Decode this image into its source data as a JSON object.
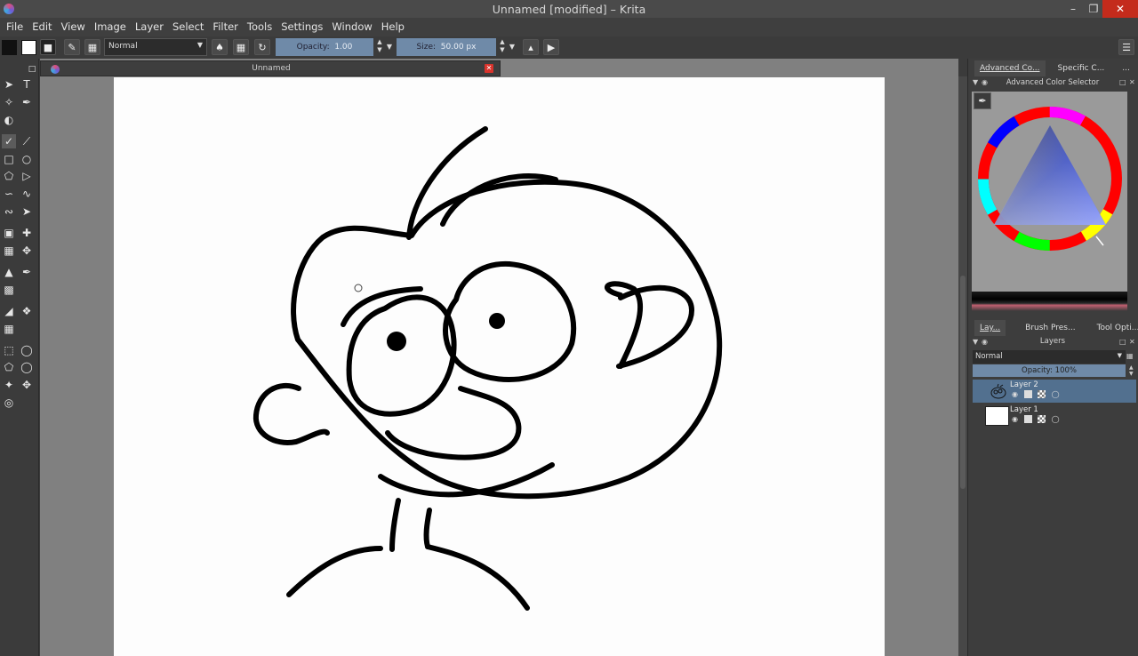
{
  "window": {
    "title": "Unnamed [modified] – Krita",
    "minimize_glyph": "–",
    "maximize_glyph": "❐",
    "close_glyph": "✕"
  },
  "menu": [
    "File",
    "Edit",
    "View",
    "Image",
    "Layer",
    "Select",
    "Filter",
    "Tools",
    "Settings",
    "Window",
    "Help"
  ],
  "tool_options": {
    "blend_mode": "Normal",
    "opacity_label": "Opacity:",
    "opacity_value": "1.00",
    "size_label": "Size:",
    "size_value": "50.00 px"
  },
  "document": {
    "tab_title": "Unnamed",
    "close_glyph": "✕"
  },
  "dock_top": {
    "tabs": [
      "Advanced Co...",
      "Specific C...",
      "..."
    ],
    "panel_title": "Advanced Color Selector"
  },
  "dock_bottom": {
    "tabs": [
      "Lay...",
      "Brush Pres...",
      "Tool Opti..."
    ],
    "panel_title": "Layers",
    "blend_mode": "Normal",
    "opacity_label": "Opacity:  100%",
    "layers": [
      {
        "name": "Layer 2",
        "selected": true
      },
      {
        "name": "Layer 1",
        "selected": false
      }
    ]
  },
  "colors": {
    "accent": "#6f8aa8",
    "selection": "#52708f",
    "close_red": "#d9332c"
  }
}
